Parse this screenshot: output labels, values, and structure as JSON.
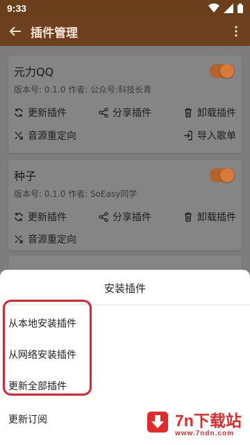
{
  "status_bar": {
    "time": "9:33"
  },
  "app_bar": {
    "title": "插件管理"
  },
  "plugins": [
    {
      "name": "元力QQ",
      "meta": "版本号: 0.1.0   作者: 公众号:科技长青",
      "enabled": true,
      "actions": {
        "update": "更新插件",
        "share": "分享插件",
        "uninstall": "卸载插件",
        "redirect": "音源重定向",
        "import": "导入歌单"
      }
    },
    {
      "name": "种子",
      "meta": "版本号: 0.1.0   作者: SoEasy同学",
      "enabled": true,
      "actions": {
        "update": "更新插件",
        "share": "分享插件",
        "uninstall": "卸载插件",
        "redirect": "音源重定向"
      }
    }
  ],
  "sheet": {
    "title": "安装插件",
    "items": [
      "从本地安装插件",
      "从网络安装插件",
      "更新全部插件",
      "更新订阅"
    ]
  },
  "watermark": {
    "text": "7n下载站",
    "url": "www.7ndn.com"
  },
  "colors": {
    "accent": "#d87a3a",
    "app_bar": "#6f4020",
    "highlight": "#e2212a"
  }
}
